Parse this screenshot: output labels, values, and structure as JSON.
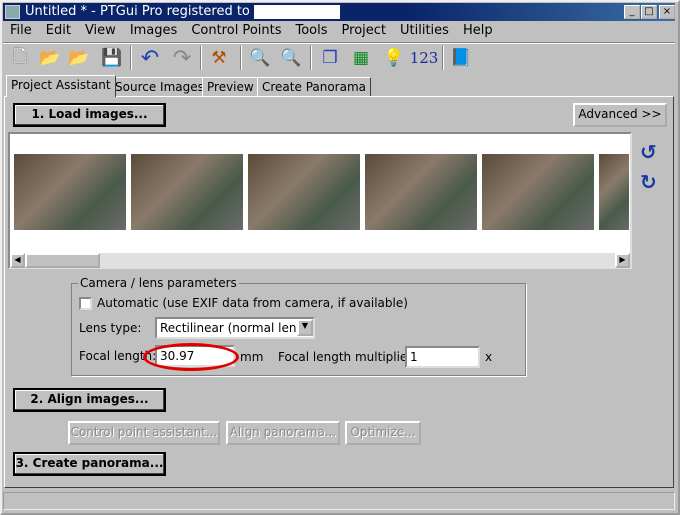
{
  "title": "Untitled * - PTGui Pro registered to",
  "window_controls": [
    "_",
    "□",
    "×"
  ],
  "menu": [
    "File",
    "Edit",
    "View",
    "Images",
    "Control Points",
    "Tools",
    "Project",
    "Utilities",
    "Help"
  ],
  "toolbar": {
    "numbers_label": "123"
  },
  "tabs": [
    "Project Assistant",
    "Source Images",
    "Preview",
    "Create Panorama"
  ],
  "load_button": "1. Load images...",
  "advanced_button": "Advanced >>",
  "camera": {
    "group_label": "Camera / lens parameters",
    "automatic_label": "Automatic (use EXIF data from camera, if available)",
    "automatic_checked": false,
    "lens_type_label": "Lens type:",
    "lens_type_value": "Rectilinear (normal lens)",
    "focal_length_label": "Focal length:",
    "focal_length_value": "30.97",
    "focal_unit": "mm",
    "multiplier_label": "Focal length multiplier:",
    "multiplier_value": "1",
    "multiplier_unit": "x"
  },
  "align_button": "2. Align images...",
  "sub_buttons": [
    "Control point assistant...",
    "Align panorama...",
    "Optimize..."
  ],
  "create_button": "3. Create panorama...",
  "highlight_color": "#e00000"
}
